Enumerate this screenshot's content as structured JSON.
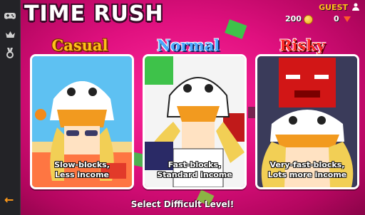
{
  "game": {
    "title": "TIME RUSH"
  },
  "profile": {
    "name": "GUEST",
    "coins": "200",
    "gems": "0"
  },
  "sidebar": {
    "items": [
      {
        "icon": "gamepad-icon"
      },
      {
        "icon": "crown-icon"
      },
      {
        "icon": "medal-icon"
      }
    ]
  },
  "modes": [
    {
      "label": "Casual",
      "caption_line1": "Slow-blocks,",
      "caption_line2": "Less income",
      "label_color": "#ffc21a"
    },
    {
      "label": "Normal",
      "caption_line1": "Fast-blocks,",
      "caption_line2": "Standard income",
      "label_color": "#49a8ff"
    },
    {
      "label": "Risky",
      "caption_line1": "Very-fast-blocks,",
      "caption_line2": "Lots more income",
      "label_color": "#ff2b2b"
    }
  ],
  "footer": {
    "text": "Select Difficult Level!"
  },
  "colors": {
    "background": "#e0107f",
    "accent": "#ffc21a"
  }
}
